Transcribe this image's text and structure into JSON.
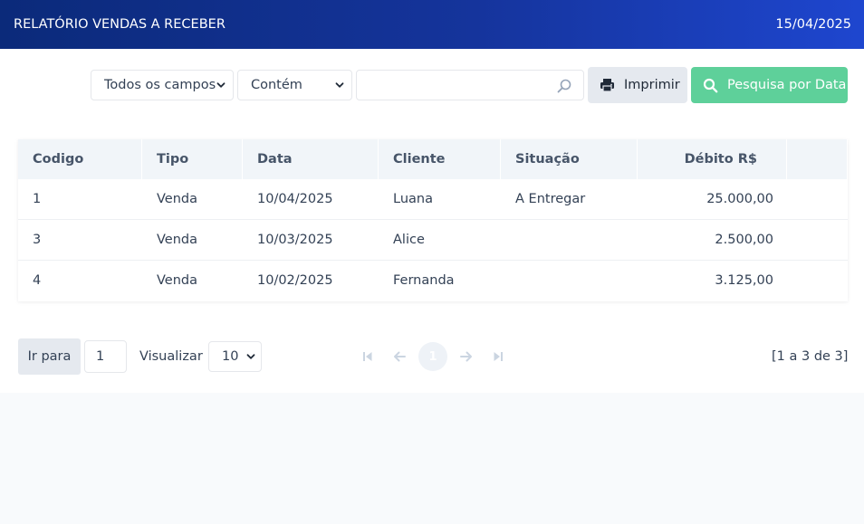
{
  "header": {
    "title": "RELATÓRIO VENDAS A RECEBER",
    "date": "15/04/2025"
  },
  "filters": {
    "field_select": "Todos os campos",
    "operator_select": "Contém",
    "search_value": "",
    "print_label": "Imprimir",
    "date_search_label": "Pesquisa por Data"
  },
  "table": {
    "columns": [
      "Codigo",
      "Tipo",
      "Data",
      "Cliente",
      "Situação",
      "Débito R$",
      ""
    ],
    "rows": [
      [
        "1",
        "Venda",
        "10/04/2025",
        "Luana",
        "A Entregar",
        "25.000,00"
      ],
      [
        "3",
        "Venda",
        "10/03/2025",
        "Alice",
        "",
        "2.500,00"
      ],
      [
        "4",
        "Venda",
        "10/02/2025",
        "Fernanda",
        "",
        "3.125,00"
      ]
    ]
  },
  "pagination": {
    "goto_label": "Ir para",
    "goto_value": "1",
    "view_label": "Visualizar",
    "page_size": "10",
    "current_page": "1",
    "range_text": "[1 a 3 de 3]"
  },
  "icons": {
    "search": "search-icon",
    "print": "printer-icon",
    "first": "first-page-icon",
    "prev": "arrow-left-icon",
    "next": "arrow-right-icon",
    "last": "last-page-icon",
    "chevron": "chevron-down-icon"
  },
  "colors": {
    "header_start": "#0b2a7a",
    "header_end": "#1e46cf",
    "accent_green": "#5ed09a"
  }
}
